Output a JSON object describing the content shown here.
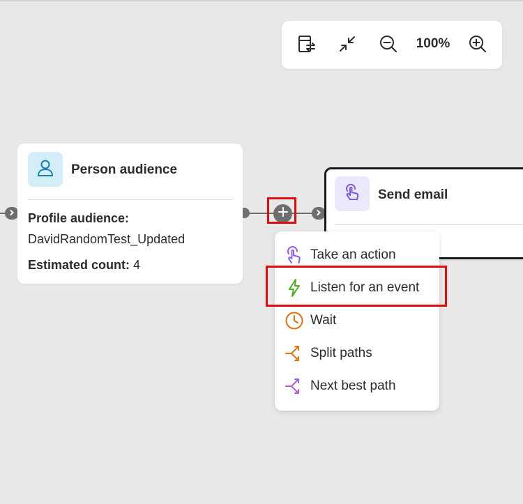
{
  "toolbar": {
    "zoom_label": "100%",
    "icons": [
      "fit-layout-icon",
      "collapse-icon",
      "zoom-out-icon",
      "zoom-in-icon"
    ]
  },
  "person_node": {
    "title": "Person audience",
    "icon": "person-icon",
    "profile_label": "Profile audience:",
    "profile_value": "DavidRandomTest_Updated",
    "count_label": "Estimated count:",
    "count_value": "4"
  },
  "email_node": {
    "title": "Send email",
    "icon": "touch-icon"
  },
  "menu": {
    "items": [
      {
        "label": "Take an action",
        "icon": "touch-icon",
        "color": "#8b5cf6"
      },
      {
        "label": "Listen for an event",
        "icon": "lightning-icon",
        "color": "#4caf1c"
      },
      {
        "label": "Wait",
        "icon": "clock-icon",
        "color": "#e8700a"
      },
      {
        "label": "Split paths",
        "icon": "split-icon",
        "color": "#e8700a"
      },
      {
        "label": "Next best path",
        "icon": "split-icon",
        "color": "#b05be0"
      }
    ]
  },
  "colors": {
    "highlight": "#e00c0c",
    "canvas": "#e8e8e8"
  }
}
